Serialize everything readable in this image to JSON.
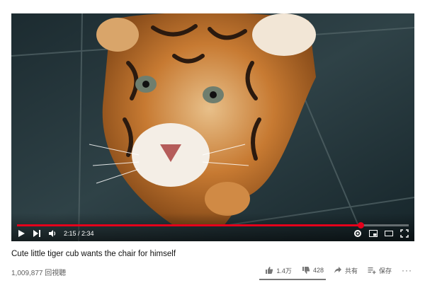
{
  "video": {
    "current_time": "2:15",
    "duration": "2:34",
    "time_display": "2:15 / 2:34",
    "progress_fraction": 0.877,
    "accent_color": "#e4001b"
  },
  "controls": {
    "icons": [
      "play-icon",
      "next-icon",
      "volume-icon",
      "settings-icon",
      "miniplayer-icon",
      "theater-icon",
      "fullscreen-icon"
    ]
  },
  "info": {
    "title": "Cute little tiger cub wants the chair for himself",
    "views": "1,009,877 回視聽"
  },
  "actions": {
    "like_count": "1.4万",
    "dislike_count": "428",
    "share_label": "共有",
    "save_label": "保存",
    "more_label": "···"
  }
}
